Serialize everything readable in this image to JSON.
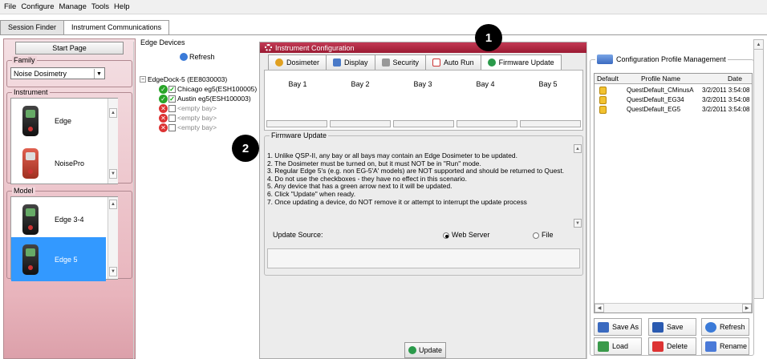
{
  "menu": [
    "File",
    "Configure",
    "Manage",
    "Tools",
    "Help"
  ],
  "main_tabs": [
    "Session Finder",
    "Instrument Communications"
  ],
  "left": {
    "start_page": "Start Page",
    "family_label": "Family",
    "family_value": "Noise Dosimetry",
    "instrument_label": "Instrument",
    "instruments": [
      "Edge",
      "NoisePro"
    ],
    "model_label": "Model",
    "models": [
      "Edge 3-4",
      "Edge 5"
    ],
    "selected_model": "Edge 5"
  },
  "edge": {
    "label": "Edge Devices",
    "refresh": "Refresh",
    "root": "EdgeDock-5 (EE8030003)",
    "bays": [
      {
        "text": "Chicago eg5(ESH100005)",
        "status": "ok"
      },
      {
        "text": "Austin eg5(ESH100003)",
        "status": "ok"
      },
      {
        "text": "<empty bay>",
        "status": "empty"
      },
      {
        "text": "<empty bay>",
        "status": "empty"
      },
      {
        "text": "<empty bay>",
        "status": "empty"
      }
    ]
  },
  "config": {
    "title": "Instrument Configuration",
    "tabs": [
      "Dosimeter",
      "Display",
      "Security",
      "Auto Run",
      "Firmware Update"
    ],
    "active_tab": "Firmware Update",
    "bays": [
      "Bay 1",
      "Bay 2",
      "Bay 3",
      "Bay 4",
      "Bay 5"
    ],
    "fw_label": "Firmware Update",
    "fw_lines": [
      "1. Unlike QSP-II, any bay or all bays may contain an Edge Dosimeter to be updated.",
      "2. The Dosimeter must be turned on, but it must NOT be in \"Run\" mode.",
      "3. Regular Edge 5's (e.g. non EG-5'A' models) are NOT supported and should be returned to Quest.",
      "4. Do not use the checkboxes - they have no effect in this scenario.",
      "5. Any device that has a green arrow next to it will be updated.",
      "6. Click \"Update\" when ready.",
      "7. Once updating a device, do NOT remove it or attempt to interrupt the update process"
    ],
    "update_source": "Update Source:",
    "web_server": "Web Server",
    "file": "File",
    "update_btn": "Update"
  },
  "profiles": {
    "label": "Configuration Profile Management",
    "headers": [
      "Default",
      "Profile Name",
      "Date"
    ],
    "rows": [
      {
        "name": "QuestDefault_CMinusA",
        "date": "3/2/2011 3:54:08"
      },
      {
        "name": "QuestDefault_EG34",
        "date": "3/2/2011 3:54:08"
      },
      {
        "name": "QuestDefault_EG5",
        "date": "3/2/2011 3:54:08"
      }
    ],
    "buttons": [
      "Save As",
      "Save",
      "Refresh",
      "Load",
      "Delete",
      "Rename"
    ]
  },
  "callouts": [
    "1",
    "2"
  ],
  "colors": {
    "title_bar": "#b0243f",
    "selected": "#3399ff",
    "left_panel": "#e8b4bc"
  }
}
